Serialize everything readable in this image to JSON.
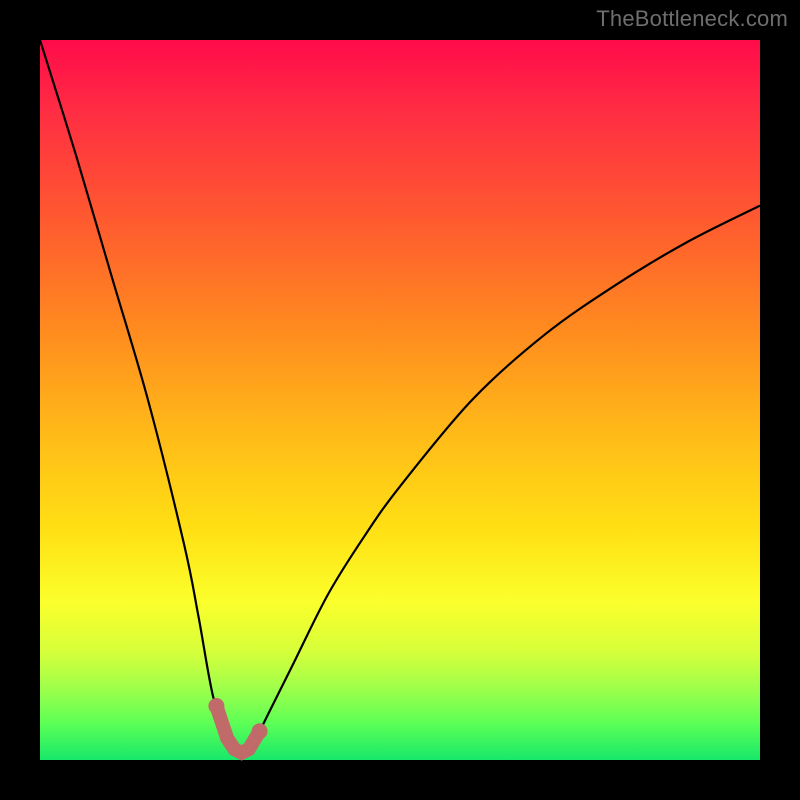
{
  "watermark": "TheBottleneck.com",
  "colors": {
    "background": "#000000",
    "curve": "#000000",
    "marker": "#c06a6a",
    "gradient_top": "#ff0b4a",
    "gradient_bottom": "#17e86a"
  },
  "chart_data": {
    "type": "line",
    "title": "",
    "xlabel": "",
    "ylabel": "",
    "xlim": [
      0,
      100
    ],
    "ylim": [
      0,
      100
    ],
    "grid": false,
    "series": [
      {
        "name": "bottleneck-curve",
        "x": [
          0,
          5,
          10,
          15,
          20,
          22,
          24,
          26,
          27,
          28,
          29,
          30,
          32,
          35,
          40,
          45,
          50,
          60,
          70,
          80,
          90,
          100
        ],
        "values": [
          100,
          84,
          67,
          50,
          30,
          20,
          9,
          3,
          1.5,
          1,
          1.5,
          3,
          7,
          13,
          23,
          31,
          38,
          50,
          59,
          66,
          72,
          77
        ]
      }
    ],
    "markers": {
      "name": "highlighted-trough",
      "x": [
        24.5,
        26,
        27,
        28,
        29,
        30.5
      ],
      "values": [
        7.5,
        3,
        1.5,
        1,
        1.5,
        4
      ]
    },
    "annotations": []
  }
}
